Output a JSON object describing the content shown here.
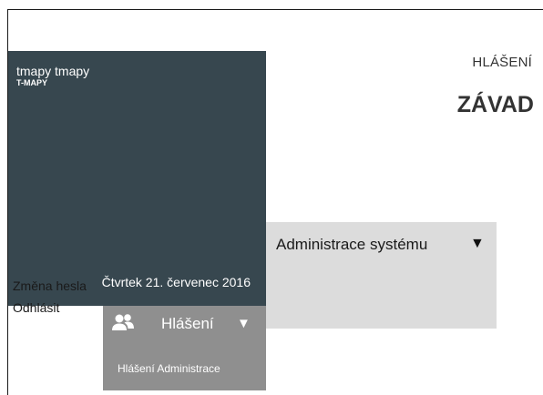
{
  "user": {
    "name": "tmapy tmapy",
    "organization": "T-MAPY",
    "date": "Čtvrtek 21. červenec 2016"
  },
  "header": {
    "label": "HLÁŠENÍ",
    "title": "ZÁVAD"
  },
  "admin_menu": {
    "label": "Administrace systému",
    "caret": "▼",
    "items": [
      {
        "label": "Změna hesla"
      },
      {
        "label": "Odhlásit"
      }
    ]
  },
  "report_menu": {
    "icon": "users-icon",
    "label": "Hlášení",
    "caret": "▼",
    "items": [
      {
        "label": "Hlášení Administrace"
      }
    ]
  },
  "colors": {
    "user_tile": "#37474f",
    "admin_menu": "#dcdcdc",
    "report_tile": "#8f8f8f"
  }
}
